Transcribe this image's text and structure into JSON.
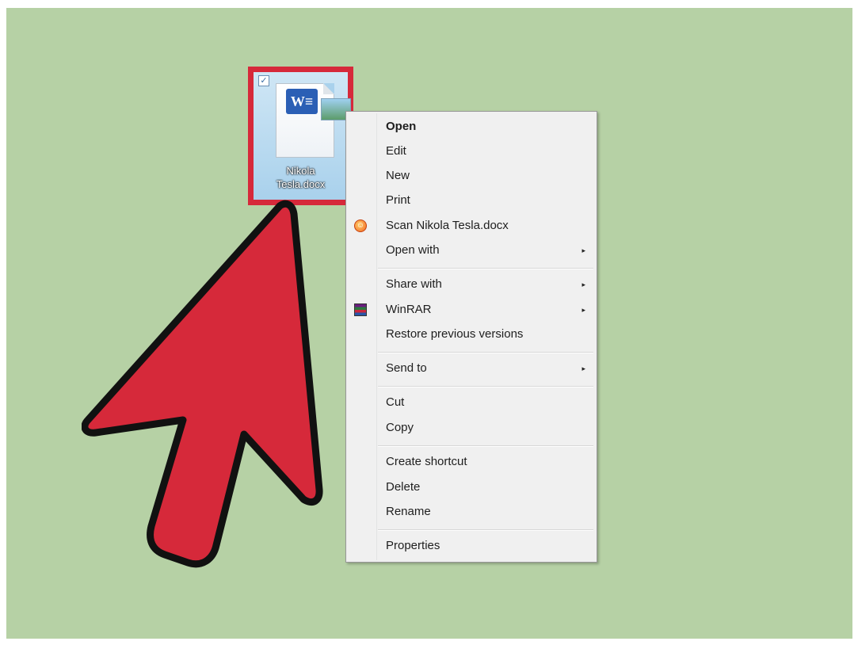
{
  "desktop": {
    "background": "#b6d1a5",
    "file": {
      "name_line1": "Nikola",
      "name_line2": "Tesla.docx",
      "icon": "word-document-icon",
      "selected": true,
      "highlight_color": "#d6293a"
    }
  },
  "annotation": {
    "arrow_color": "#d6293a",
    "icon": "red-arrow-pointer"
  },
  "context_menu": {
    "items": [
      {
        "label": "Open",
        "bold": true
      },
      {
        "label": "Edit"
      },
      {
        "label": "New"
      },
      {
        "label": "Print"
      },
      {
        "label": "Scan Nikola Tesla.docx",
        "icon": "antivirus-scan-icon"
      },
      {
        "label": "Open with",
        "submenu": true
      },
      {
        "label": "Share with",
        "submenu": true
      },
      {
        "label": "WinRAR",
        "submenu": true,
        "icon": "winrar-icon"
      },
      {
        "label": "Restore previous versions"
      },
      {
        "label": "Send to",
        "submenu": true
      },
      {
        "label": "Cut"
      },
      {
        "label": "Copy"
      },
      {
        "label": "Create shortcut"
      },
      {
        "label": "Delete"
      },
      {
        "label": "Rename"
      },
      {
        "label": "Properties"
      }
    ],
    "submenu_glyph": "▸"
  }
}
